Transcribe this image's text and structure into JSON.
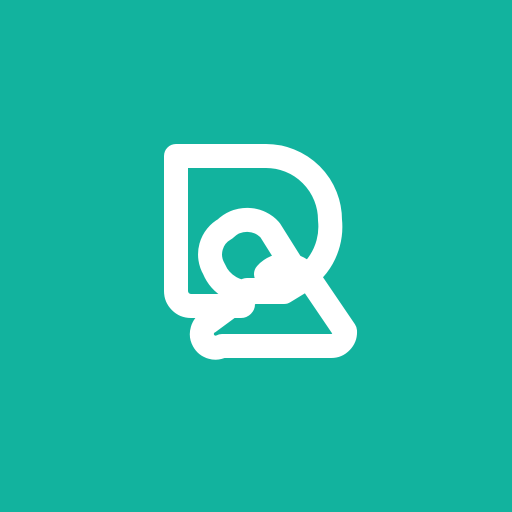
{
  "icon": {
    "name": "r-logo-icon",
    "background_color": "#12B39E",
    "mark_color": "#FFFFFF"
  }
}
